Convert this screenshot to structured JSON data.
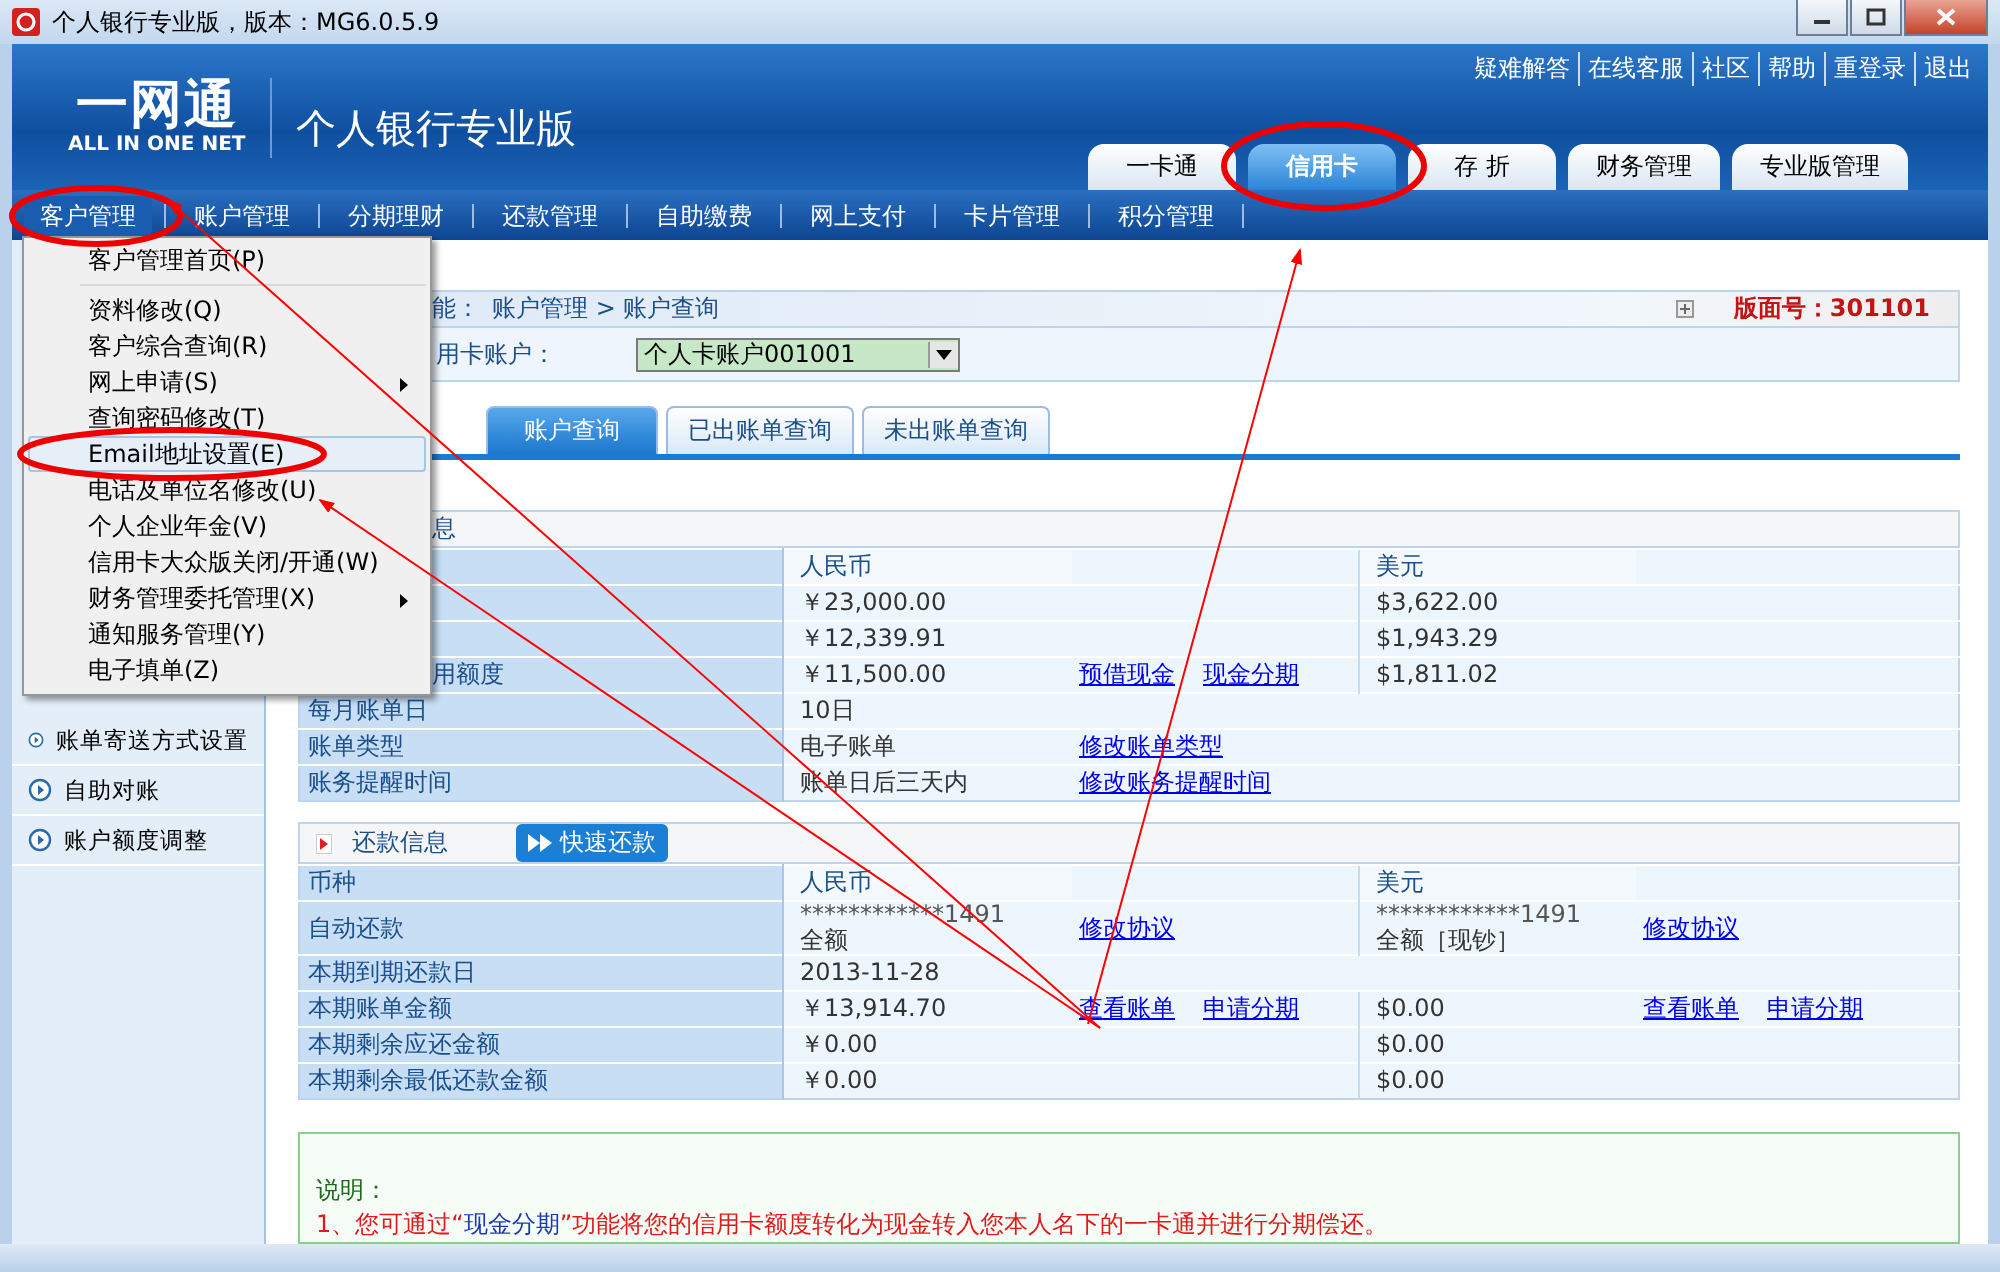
{
  "window": {
    "title": "个人银行专业版，版本：MG6.0.5.9"
  },
  "header": {
    "logo_cn": "一网通",
    "logo_en": "ALL IN ONE NET",
    "product": "个人银行专业版",
    "links": [
      "疑难解答",
      "在线客服",
      "社区",
      "帮助",
      "重登录",
      "退出"
    ],
    "tabs": [
      {
        "label": "一卡通",
        "selected": false
      },
      {
        "label": "信用卡",
        "selected": true
      },
      {
        "label": "存 折",
        "selected": false
      },
      {
        "label": "财务管理",
        "selected": false
      },
      {
        "label": "专业版管理",
        "selected": false
      }
    ]
  },
  "menubar": [
    {
      "label": "客户管理",
      "selected": true
    },
    {
      "label": "账户管理",
      "selected": false
    },
    {
      "label": "分期理财",
      "selected": false
    },
    {
      "label": "还款管理",
      "selected": false
    },
    {
      "label": "自助缴费",
      "selected": false
    },
    {
      "label": "网上支付",
      "selected": false
    },
    {
      "label": "卡片管理",
      "selected": false
    },
    {
      "label": "积分管理",
      "selected": false
    }
  ],
  "dropdown": [
    {
      "label": "客户管理首页(P)",
      "selected": false,
      "submenu": false,
      "separator_after": true
    },
    {
      "label": "资料修改(Q)",
      "selected": false,
      "submenu": false
    },
    {
      "label": "客户综合查询(R)",
      "selected": false,
      "submenu": false
    },
    {
      "label": "网上申请(S)",
      "selected": false,
      "submenu": true
    },
    {
      "label": "查询密码修改(T)",
      "selected": false,
      "submenu": false
    },
    {
      "label": "Email地址设置(E)",
      "selected": true,
      "submenu": false
    },
    {
      "label": "电话及单位名修改(U)",
      "selected": false,
      "submenu": false
    },
    {
      "label": "个人企业年金(V)",
      "selected": false,
      "submenu": false
    },
    {
      "label": "信用卡大众版关闭/开通(W)",
      "selected": false,
      "submenu": false
    },
    {
      "label": "财务管理委托管理(X)",
      "selected": false,
      "submenu": true
    },
    {
      "label": "通知服务管理(Y)",
      "selected": false,
      "submenu": false
    },
    {
      "label": "电子填单(Z)",
      "selected": false,
      "submenu": false
    }
  ],
  "sidebar": {
    "items": [
      "账单寄送方式设置",
      "自助对账",
      "账户额度调整"
    ]
  },
  "breadcrumb": {
    "label": "能：",
    "path": "账户管理 > 账户查询",
    "page_no": "版面号：301101"
  },
  "account": {
    "label": "用卡账户：",
    "value": "个人卡账户001001"
  },
  "subtabs": [
    {
      "label": "账户查询",
      "selected": true
    },
    {
      "label": "已出账单查询",
      "selected": false
    },
    {
      "label": "未出账单查询",
      "selected": false
    }
  ],
  "account_info": {
    "title": "息",
    "rows": [
      {
        "rmb": "人民币",
        "usd": "美元",
        "kind": "head"
      },
      {
        "rmb": "￥23,000.00",
        "usd": "$3,622.00"
      },
      {
        "rmb": "￥12,339.91",
        "usd": "$1,943.29"
      },
      {
        "label": "用额度",
        "rmb": "￥11,500.00",
        "rmb_links": [
          "预借现金",
          "现金分期"
        ],
        "usd": "$1,811.02"
      },
      {
        "label": "每月账单日",
        "rmb": "10日"
      },
      {
        "label": "账单类型",
        "rmb": "电子账单",
        "rmb_links": [
          "修改账单类型"
        ]
      },
      {
        "label": "账务提醒时间",
        "rmb": "账单日后三天内",
        "rmb_links": [
          "修改账务提醒时间"
        ]
      }
    ]
  },
  "repay_info": {
    "title": "还款信息",
    "button": "快速还款",
    "rows": [
      {
        "label": "币种",
        "rmb": "人民币",
        "usd": "美元",
        "kind": "head"
      },
      {
        "label": "自动还款",
        "rmb": "************1491",
        "rmb_note": "全额",
        "rmb_links": [
          "修改协议"
        ],
        "usd": "************1491",
        "usd_note": "全额［现钞］",
        "usd_links": [
          "修改协议"
        ]
      },
      {
        "label": "本期到期还款日",
        "rmb": "2013-11-28"
      },
      {
        "label": "本期账单金额",
        "rmb": "￥13,914.70",
        "rmb_links": [
          "查看账单",
          "申请分期"
        ],
        "usd": "$0.00",
        "usd_links": [
          "查看账单",
          "申请分期"
        ]
      },
      {
        "label": "本期剩余应还金额",
        "rmb": "￥0.00",
        "usd": "$0.00"
      },
      {
        "label": "本期剩余最低还款金额",
        "rmb": "￥0.00",
        "usd": "$0.00"
      }
    ]
  },
  "note": {
    "title": "说明：",
    "line": "1、您可通过“*现金分期*”功能将您的信用卡额度转化为现金转入您本人名下的一卡通并进行分期偿还。"
  }
}
